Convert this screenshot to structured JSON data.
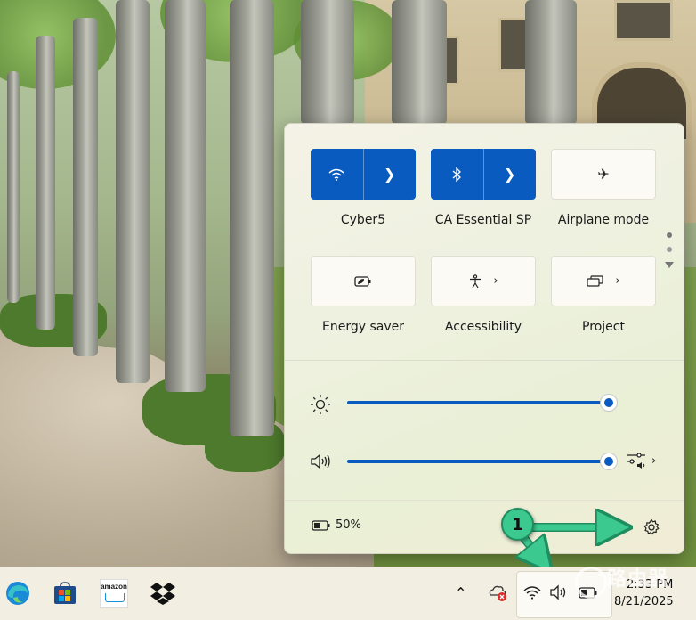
{
  "flyout": {
    "tiles": [
      {
        "label": "Cyber5",
        "icon": "wifi-icon",
        "state": "on",
        "expandable": true
      },
      {
        "label": "CA Essential SP",
        "icon": "bluetooth-icon",
        "state": "on",
        "expandable": true
      },
      {
        "label": "Airplane mode",
        "icon": "airplane-icon",
        "state": "off",
        "expandable": false
      },
      {
        "label": "Energy saver",
        "icon": "energy-saver-icon",
        "state": "off",
        "expandable": false
      },
      {
        "label": "Accessibility",
        "icon": "accessibility-icon",
        "state": "off",
        "expandable": true
      },
      {
        "label": "Project",
        "icon": "project-icon",
        "state": "off",
        "expandable": true
      }
    ],
    "brightness": {
      "icon": "sun-icon",
      "level": 1.0
    },
    "volume": {
      "icon": "speaker-icon",
      "level": 1.0,
      "mixer_icon": "audio-mixer-icon"
    },
    "battery": {
      "icon": "battery-icon",
      "percent": "50%"
    },
    "settings_icon": "gear-icon",
    "pager": {
      "pages": 2,
      "current": 1
    }
  },
  "taskbar": {
    "apps": [
      {
        "name": "Microsoft Edge",
        "icon": "edge-icon"
      },
      {
        "name": "Microsoft Store",
        "icon": "store-icon"
      },
      {
        "name": "Amazon",
        "icon": "amazon-icon",
        "text": "amazon"
      },
      {
        "name": "Dropbox",
        "icon": "dropbox-icon"
      }
    ],
    "tray": {
      "overflow_icon": "chevron-up-icon",
      "onedrive_icon": "onedrive-error-icon",
      "wifi_icon": "wifi-icon",
      "volume_icon": "speaker-icon",
      "battery_icon": "battery-charging-icon"
    },
    "clock": {
      "time": "2:33 PM",
      "date": "8/21/2025"
    }
  },
  "annotation": {
    "badge_label": "1",
    "color": "#3cc98f"
  },
  "watermark": {
    "text": "路由器"
  },
  "colors": {
    "accent": "#0a5bc0",
    "flyout_bg": "#eef1df",
    "taskbar_bg": "#f2efe2"
  }
}
